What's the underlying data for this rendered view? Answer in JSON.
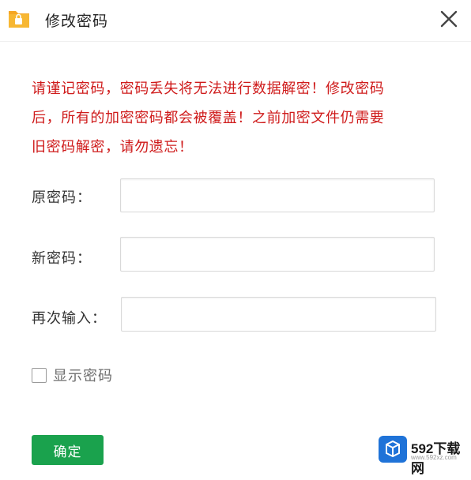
{
  "window": {
    "title": "修改密码",
    "icon": "folder-lock-icon",
    "close_icon": "close-icon"
  },
  "warning": {
    "lines": [
      "请谨记密码，密码丢失将无法进行数据解密！修改密码",
      "后，所有的加密密码都会被覆盖！之前加密文件仍需要",
      "旧密码解密，请勿遗忘！"
    ],
    "color": "#cf1b1b"
  },
  "form": {
    "old_password_label": "原密码：",
    "new_password_label": "新密码：",
    "confirm_label": "再次输入：",
    "show_password_label": "显示密码",
    "show_password_checked": false
  },
  "actions": {
    "ok_label": "确定",
    "ok_color": "#1aa24d"
  },
  "watermark": {
    "text": "592下载网",
    "sub": "www.592xz.com"
  }
}
